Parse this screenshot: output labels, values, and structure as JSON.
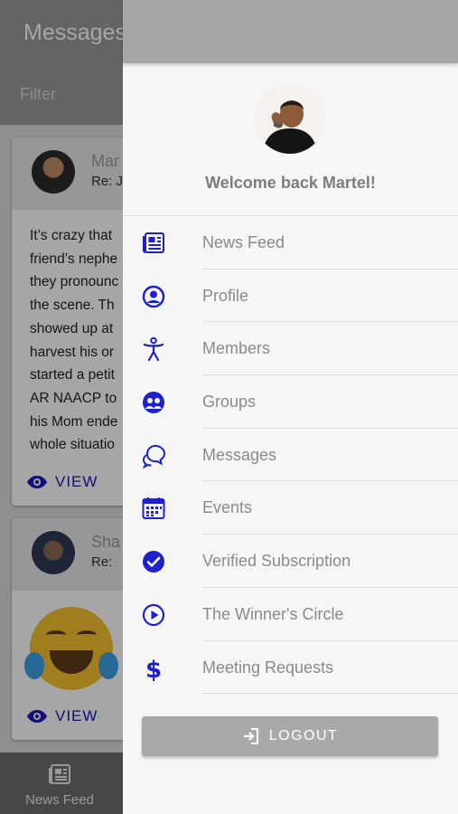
{
  "background": {
    "header_title": "Messages",
    "filter_placeholder": "Filter",
    "cards": [
      {
        "name": "Mar",
        "subject": "Re: J",
        "body_lines": [
          "It’s crazy that",
          "friend’s nephe",
          "they pronounc",
          "the scene. Th",
          "showed up at",
          "harvest his or",
          "started a petit",
          "AR NAACP to",
          "his Mom ende",
          "whole situatio"
        ],
        "view_label": "VIEW"
      },
      {
        "name": "Sha",
        "subject": "Re:",
        "view_label": "VIEW"
      }
    ],
    "bottom_nav": {
      "label": "News Feed"
    }
  },
  "drawer": {
    "welcome": "Welcome back Martel!",
    "menu": [
      {
        "label": "News Feed",
        "icon": "newspaper-icon"
      },
      {
        "label": "Profile",
        "icon": "user-circle-icon"
      },
      {
        "label": "Members",
        "icon": "person-accessibility-icon"
      },
      {
        "label": "Groups",
        "icon": "groups-icon"
      },
      {
        "label": "Messages",
        "icon": "chat-bubbles-icon"
      },
      {
        "label": "Events",
        "icon": "calendar-icon"
      },
      {
        "label": "Verified Subscription",
        "icon": "check-circle-icon"
      },
      {
        "label": "The Winner's Circle",
        "icon": "play-circle-icon"
      },
      {
        "label": "Meeting Requests",
        "icon": "dollar-icon"
      }
    ],
    "logout_label": "LOGOUT"
  },
  "colors": {
    "accent": "#1c20cf",
    "drawer_bg": "#f7f6f6",
    "logout_bg": "#a9a9a9"
  }
}
